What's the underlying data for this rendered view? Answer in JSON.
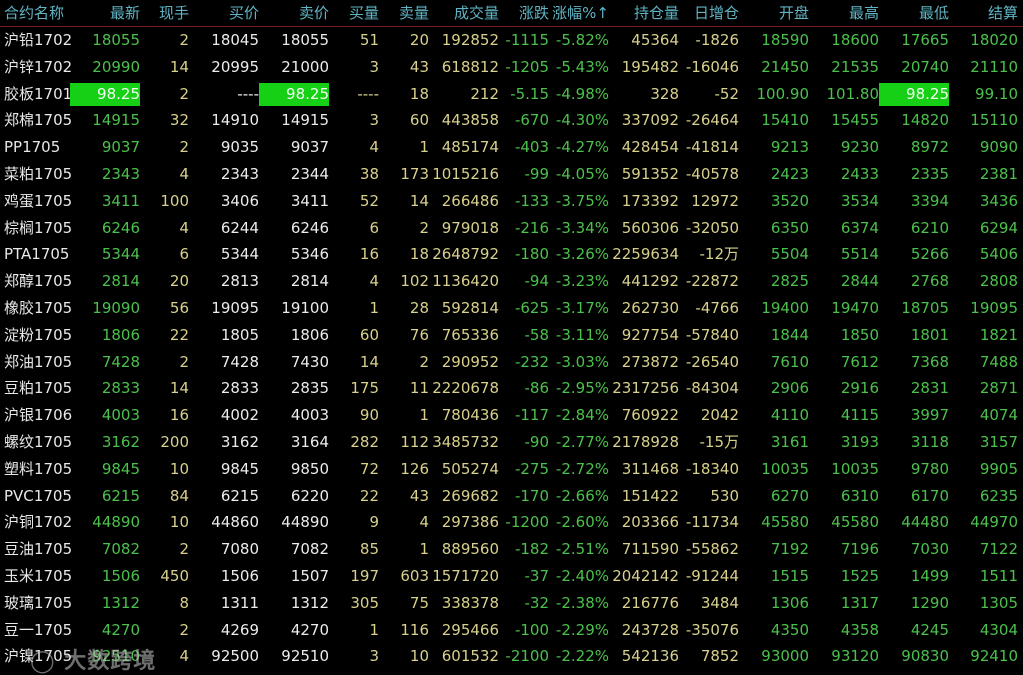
{
  "headers": [
    "合约名称",
    "最新",
    "现手",
    "买价",
    "卖价",
    "买量",
    "卖量",
    "成交量",
    "涨跌",
    "涨幅%↑",
    "持仓量",
    "日增仓",
    "开盘",
    "最高",
    "最低",
    "结算"
  ],
  "colors": {
    "background": "#000000",
    "header": "#5fb4c4",
    "price_down": "#4cc04c",
    "volume": "#d8d08c",
    "bid_ask": "#ececec",
    "highlight": "#16d016"
  },
  "sort_indicator": "涨幅% ascending-arrow",
  "rows": [
    [
      "沪铅1702",
      "18055",
      "2",
      "18045",
      "18055",
      "51",
      "20",
      "192852",
      "-1115",
      "-5.82%",
      "45364",
      "-1826",
      "18590",
      "18600",
      "17665",
      "18020"
    ],
    [
      "沪锌1702",
      "20990",
      "14",
      "20995",
      "21000",
      "3",
      "43",
      "618812",
      "-1205",
      "-5.43%",
      "195482",
      "-16046",
      "21450",
      "21535",
      "20740",
      "21110"
    ],
    [
      "胶板1701",
      "98.25",
      "2",
      "----",
      "98.25",
      "----",
      "18",
      "212",
      "-5.15",
      "-4.98%",
      "328",
      "-52",
      "100.90",
      "101.80",
      "98.25",
      "99.10"
    ],
    [
      "郑棉1705",
      "14915",
      "32",
      "14910",
      "14915",
      "3",
      "60",
      "443858",
      "-670",
      "-4.30%",
      "337092",
      "-26464",
      "15410",
      "15455",
      "14820",
      "15110"
    ],
    [
      " PP1705",
      "9037",
      "2",
      "9035",
      "9037",
      "4",
      "1",
      "485174",
      "-403",
      "-4.27%",
      "428454",
      "-41814",
      "9213",
      "9230",
      "8972",
      "9090"
    ],
    [
      "菜粕1705",
      "2343",
      "4",
      "2343",
      "2344",
      "38",
      "173",
      "1015216",
      "-99",
      "-4.05%",
      "591352",
      "-40578",
      "2423",
      "2433",
      "2335",
      "2381"
    ],
    [
      "鸡蛋1705",
      "3411",
      "100",
      "3406",
      "3411",
      "52",
      "14",
      "266486",
      "-133",
      "-3.75%",
      "173392",
      "12972",
      "3520",
      "3534",
      "3394",
      "3436"
    ],
    [
      "棕榈1705",
      "6246",
      "4",
      "6244",
      "6246",
      "6",
      "2",
      "979018",
      "-216",
      "-3.34%",
      "560306",
      "-32050",
      "6350",
      "6374",
      "6210",
      "6294"
    ],
    [
      " PTA1705",
      "5344",
      "6",
      "5344",
      "5346",
      "16",
      "18",
      "2648792",
      "-180",
      "-3.26%",
      "2259634",
      "-12万",
      "5504",
      "5514",
      "5266",
      "5406"
    ],
    [
      "郑醇1705",
      "2814",
      "20",
      "2813",
      "2814",
      "4",
      "102",
      "1136420",
      "-94",
      "-3.23%",
      "441292",
      "-22872",
      "2825",
      "2844",
      "2768",
      "2808"
    ],
    [
      "橡胶1705",
      "19090",
      "56",
      "19095",
      "19100",
      "1",
      "28",
      "592814",
      "-625",
      "-3.17%",
      "262730",
      "-4766",
      "19400",
      "19470",
      "18705",
      "19095"
    ],
    [
      "淀粉1705",
      "1806",
      "22",
      "1805",
      "1806",
      "60",
      "76",
      "765336",
      "-58",
      "-3.11%",
      "927754",
      "-57840",
      "1844",
      "1850",
      "1801",
      "1821"
    ],
    [
      "郑油1705",
      "7428",
      "2",
      "7428",
      "7430",
      "14",
      "2",
      "290952",
      "-232",
      "-3.03%",
      "273872",
      "-26540",
      "7610",
      "7612",
      "7368",
      "7488"
    ],
    [
      "豆粕1705",
      "2833",
      "14",
      "2833",
      "2835",
      "175",
      "11",
      "2220678",
      "-86",
      "-2.95%",
      "2317256",
      "-84304",
      "2906",
      "2916",
      "2831",
      "2871"
    ],
    [
      "沪银1706",
      "4003",
      "16",
      "4002",
      "4003",
      "90",
      "1",
      "780436",
      "-117",
      "-2.84%",
      "760922",
      "2042",
      "4110",
      "4115",
      "3997",
      "4074"
    ],
    [
      "螺纹1705",
      "3162",
      "200",
      "3162",
      "3164",
      "282",
      "112",
      "3485732",
      "-90",
      "-2.77%",
      "2178928",
      "-15万",
      "3161",
      "3193",
      "3118",
      "3157"
    ],
    [
      "塑料1705",
      "9845",
      "10",
      "9845",
      "9850",
      "72",
      "126",
      "505274",
      "-275",
      "-2.72%",
      "311468",
      "-18340",
      "10035",
      "10035",
      "9780",
      "9905"
    ],
    [
      " PVC1705",
      "6215",
      "84",
      "6215",
      "6220",
      "22",
      "43",
      "269682",
      "-170",
      "-2.66%",
      "151422",
      "530",
      "6270",
      "6310",
      "6170",
      "6235"
    ],
    [
      "沪铜1702",
      "44890",
      "10",
      "44860",
      "44890",
      "9",
      "4",
      "297386",
      "-1200",
      "-2.60%",
      "203366",
      "-11734",
      "45580",
      "45580",
      "44480",
      "44970"
    ],
    [
      "豆油1705",
      "7082",
      "2",
      "7080",
      "7082",
      "85",
      "1",
      "889560",
      "-182",
      "-2.51%",
      "711590",
      "-55862",
      "7192",
      "7196",
      "7030",
      "7122"
    ],
    [
      "玉米1705",
      "1506",
      "450",
      "1506",
      "1507",
      "197",
      "603",
      "1571720",
      "-37",
      "-2.40%",
      "2042142",
      "-91244",
      "1515",
      "1525",
      "1499",
      "1511"
    ],
    [
      "玻璃1705",
      "1312",
      "8",
      "1311",
      "1312",
      "305",
      "75",
      "338378",
      "-32",
      "-2.38%",
      "216776",
      "3484",
      "1306",
      "1317",
      "1290",
      "1305"
    ],
    [
      "豆一1705",
      "4270",
      "2",
      "4269",
      "4270",
      "1",
      "116",
      "295466",
      "-100",
      "-2.29%",
      "243728",
      "-35076",
      "4350",
      "4358",
      "4245",
      "4304"
    ],
    [
      "沪镍1705",
      "92510",
      "4",
      "92500",
      "92510",
      "3",
      "10",
      "601532",
      "-2100",
      "-2.22%",
      "542136",
      "7852",
      "93000",
      "93120",
      "90830",
      "92410"
    ]
  ],
  "highlights": [
    [
      2,
      1
    ],
    [
      2,
      4
    ],
    [
      2,
      14
    ]
  ],
  "watermark": "大数跨境"
}
